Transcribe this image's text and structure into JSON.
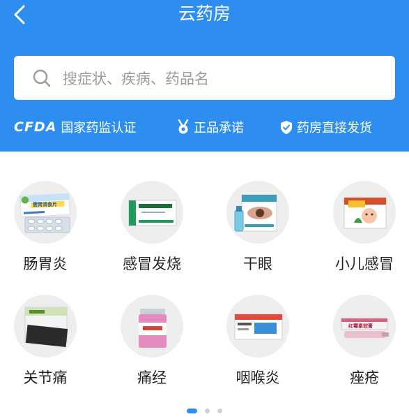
{
  "header": {
    "title": "云药房",
    "back_icon": "chevron-left-icon"
  },
  "search": {
    "placeholder": "搜症状、疾病、药品名",
    "icon": "search-icon"
  },
  "badges": {
    "cfda_logo": "CFDA",
    "cfda_label": "国家药监认证",
    "genuine_label": "正品承诺",
    "direct_label": "药房直接发货"
  },
  "categories": [
    {
      "label": "肠胃炎",
      "product": "健胃消食片"
    },
    {
      "label": "感冒发烧"
    },
    {
      "label": "干眼"
    },
    {
      "label": "小儿感冒"
    },
    {
      "label": "关节痛"
    },
    {
      "label": "痛经"
    },
    {
      "label": "咽喉炎"
    },
    {
      "label": "痤疮",
      "product": "红霉素软膏"
    }
  ],
  "pager": {
    "count": 3,
    "active": 0
  },
  "colors": {
    "brand": "#2e8ef0",
    "icon_bg": "#eeeeef"
  }
}
